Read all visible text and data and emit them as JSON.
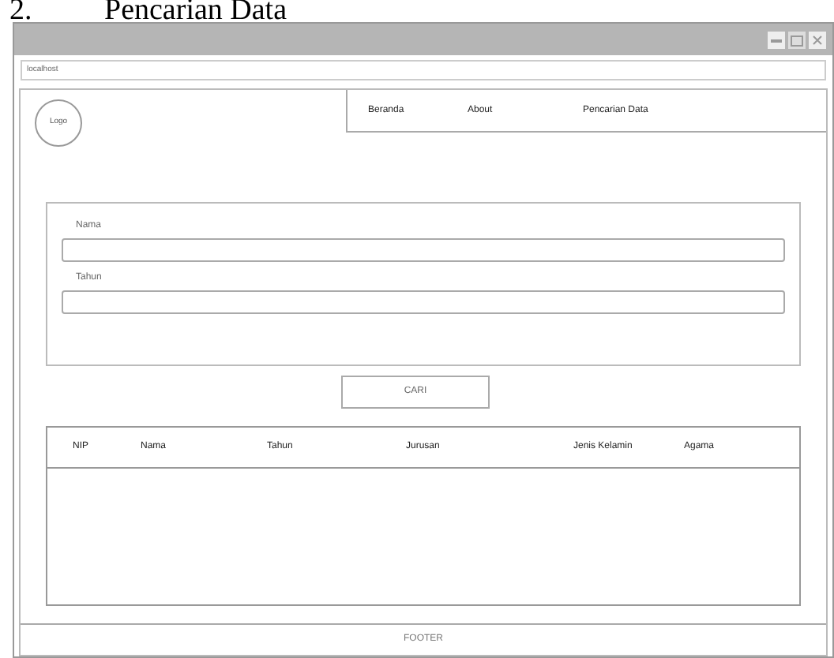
{
  "heading": {
    "number": "2.",
    "title": "Pencarian Data"
  },
  "address_bar": {
    "value": "localhost"
  },
  "header": {
    "logo": "Logo",
    "nav": [
      "Beranda",
      "About",
      "Pencarian Data"
    ]
  },
  "form": {
    "fields": [
      {
        "label": "Nama"
      },
      {
        "label": "Tahun"
      }
    ],
    "button": "CARI"
  },
  "table": {
    "columns": [
      "NIP",
      "Nama",
      "Tahun",
      "Jurusan",
      "Jenis Kelamin",
      "Agama"
    ]
  },
  "footer": "FOOTER"
}
